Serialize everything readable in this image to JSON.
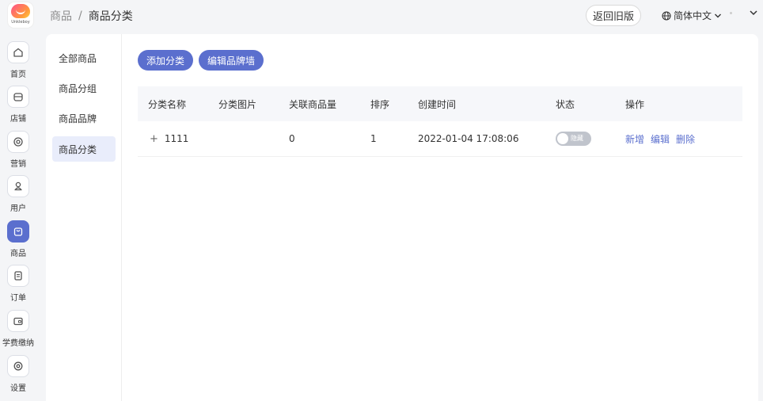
{
  "header": {
    "logo_text": "Unkleboy",
    "breadcrumb": {
      "root": "商品",
      "separator": "/",
      "current": "商品分类"
    },
    "back_old_label": "返回旧版",
    "language": "简体中文"
  },
  "nav": {
    "items": [
      {
        "label": "首页",
        "icon": "home-icon"
      },
      {
        "label": "店铺",
        "icon": "shop-icon"
      },
      {
        "label": "营销",
        "icon": "marketing-icon"
      },
      {
        "label": "用户",
        "icon": "user-icon"
      },
      {
        "label": "商品",
        "icon": "bag-icon",
        "active": true
      },
      {
        "label": "订单",
        "icon": "order-icon"
      },
      {
        "label": "学费缴纳",
        "icon": "wallet-icon"
      },
      {
        "label": "设置",
        "icon": "gear-icon"
      }
    ]
  },
  "subnav": {
    "items": [
      {
        "label": "全部商品"
      },
      {
        "label": "商品分组"
      },
      {
        "label": "商品品牌"
      },
      {
        "label": "商品分类",
        "active": true
      }
    ]
  },
  "toolbar": {
    "add_category_label": "添加分类",
    "edit_brand_wall_label": "编辑品牌墙"
  },
  "table": {
    "columns": [
      "分类名称",
      "分类图片",
      "关联商品量",
      "排序",
      "创建时间",
      "状态",
      "操作"
    ],
    "rows": [
      {
        "expand": "+",
        "name": "1111",
        "image": "",
        "product_count": "0",
        "sort": "1",
        "created": "2022-01-04 17:08:06",
        "status_label": "隐藏",
        "actions": {
          "add": "新增",
          "edit": "编辑",
          "delete": "删除"
        }
      }
    ]
  },
  "colors": {
    "accent": "#5b6fce",
    "page_bg": "#f4f5f7",
    "header_row_bg": "#f6f7fa",
    "subnav_active_bg": "#e9edfb",
    "switch_off": "#c0c4cc"
  }
}
